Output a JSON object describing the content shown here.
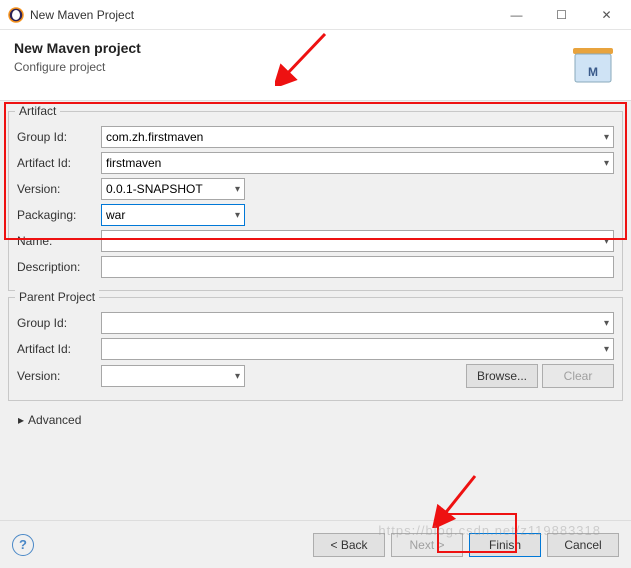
{
  "titlebar": {
    "title": "New Maven Project"
  },
  "header": {
    "title": "New Maven project",
    "subtitle": "Configure project"
  },
  "artifact": {
    "legend": "Artifact",
    "groupId": {
      "label": "Group Id:",
      "value": "com.zh.firstmaven"
    },
    "artifactId": {
      "label": "Artifact Id:",
      "value": "firstmaven"
    },
    "version": {
      "label": "Version:",
      "value": "0.0.1-SNAPSHOT"
    },
    "packaging": {
      "label": "Packaging:",
      "value": "war"
    },
    "name": {
      "label": "Name:",
      "value": ""
    },
    "description": {
      "label": "Description:",
      "value": ""
    }
  },
  "parent": {
    "legend": "Parent Project",
    "groupId": {
      "label": "Group Id:",
      "value": ""
    },
    "artifactId": {
      "label": "Artifact Id:",
      "value": ""
    },
    "version": {
      "label": "Version:",
      "value": ""
    },
    "browse": "Browse...",
    "clear": "Clear"
  },
  "advanced": {
    "label": "Advanced"
  },
  "footer": {
    "back": "< Back",
    "next": "Next >",
    "finish": "Finish",
    "cancel": "Cancel"
  },
  "watermark": "https://blog.csdn.net/z119883318"
}
